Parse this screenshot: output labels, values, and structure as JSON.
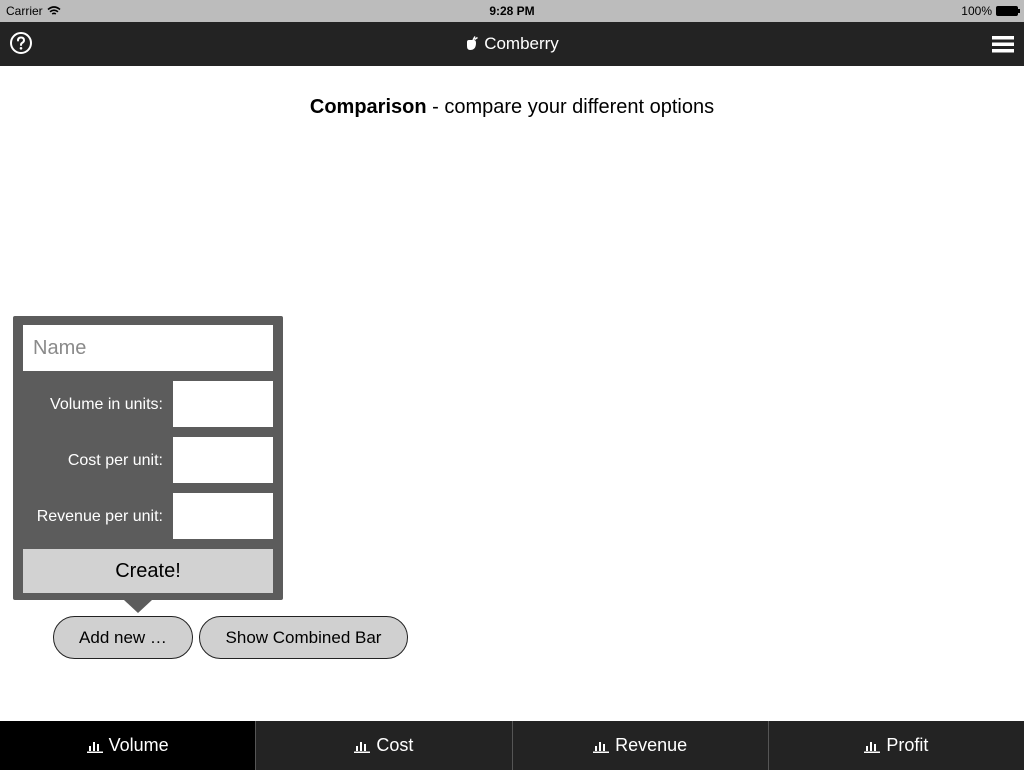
{
  "status_bar": {
    "carrier": "Carrier",
    "time": "9:28 PM",
    "battery": "100%"
  },
  "nav": {
    "title": "Comberry",
    "help_icon": "question-circle-icon",
    "menu_icon": "hamburger-menu-icon",
    "logo_icon": "berry-icon"
  },
  "heading": {
    "bold": "Comparison",
    "rest": " - compare your different options"
  },
  "form": {
    "name_placeholder": "Name",
    "name_value": "",
    "fields": [
      {
        "label": "Volume in units:",
        "value": ""
      },
      {
        "label": "Cost per unit:",
        "value": ""
      },
      {
        "label": "Revenue per unit:",
        "value": ""
      }
    ],
    "create_label": "Create!"
  },
  "buttons": {
    "add_new": "Add new …",
    "show_combined": "Show Combined Bar"
  },
  "tabs": [
    {
      "label": "Volume",
      "icon": "bar-chart-icon",
      "active": true
    },
    {
      "label": "Cost",
      "icon": "bar-chart-icon",
      "active": false
    },
    {
      "label": "Revenue",
      "icon": "bar-chart-icon",
      "active": false
    },
    {
      "label": "Profit",
      "icon": "bar-chart-icon",
      "active": false
    }
  ],
  "colors": {
    "bar_bg": "#232323",
    "active_tab": "#000000",
    "popover_bg": "#5c5c5c",
    "button_bg": "#d0d0d0"
  }
}
